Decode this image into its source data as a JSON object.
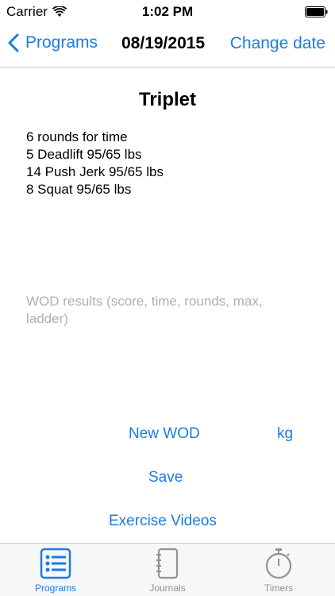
{
  "status_bar": {
    "carrier": "Carrier",
    "time": "1:02 PM"
  },
  "nav": {
    "back_label": "Programs",
    "date": "08/19/2015",
    "change_date_label": "Change date"
  },
  "wod": {
    "title": "Triplet",
    "lines": [
      "6 rounds for time",
      "5 Deadlift 95/65 lbs",
      "14 Push Jerk 95/65 lbs",
      "8 Squat 95/65 lbs"
    ]
  },
  "results": {
    "placeholder": "WOD results (score, time, rounds, max, ladder)",
    "value": ""
  },
  "actions": {
    "new_wod_label": "New WOD",
    "unit_label": "kg",
    "save_label": "Save",
    "exercise_videos_label": "Exercise Videos"
  },
  "tabs": [
    {
      "label": "Programs",
      "icon": "list-icon",
      "selected": true
    },
    {
      "label": "Journals",
      "icon": "notebook-icon",
      "selected": false
    },
    {
      "label": "Timers",
      "icon": "stopwatch-icon",
      "selected": false
    }
  ],
  "colors": {
    "accent": "#1a7de0",
    "tab_inactive": "#929292",
    "placeholder": "#b0b0b5"
  }
}
